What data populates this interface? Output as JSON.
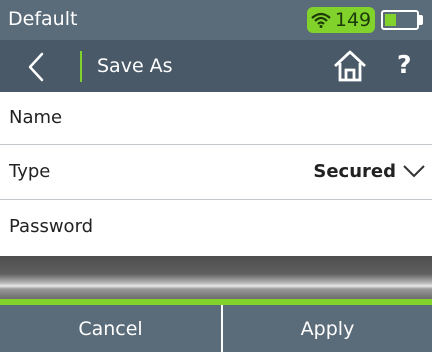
{
  "status_bar": {
    "profile": "Default",
    "signal_value": "149",
    "battery_level": 0.35,
    "accent_color": "#82d22c"
  },
  "header": {
    "back_icon": "chevron-left-icon",
    "title": "Save As",
    "home_icon": "home-icon",
    "help_label": "?"
  },
  "form": {
    "name_label": "Name",
    "type_label": "Type",
    "type_value": "Secured",
    "password_label": "Password"
  },
  "buttons": {
    "cancel": "Cancel",
    "apply": "Apply"
  }
}
